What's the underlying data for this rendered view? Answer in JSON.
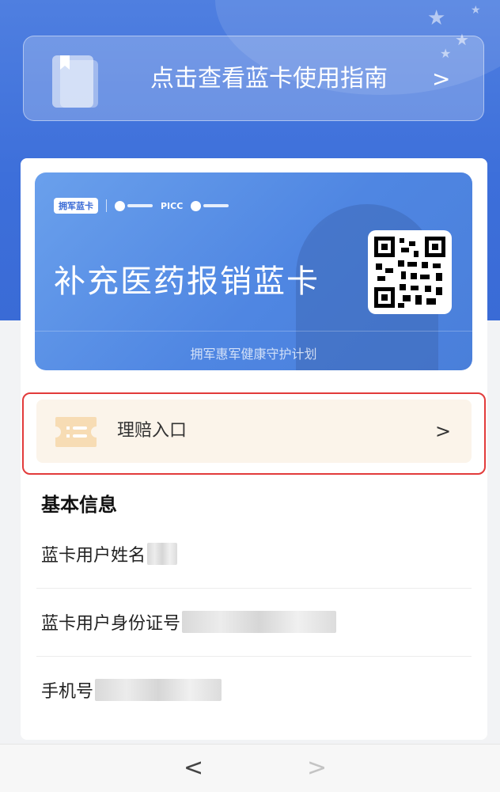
{
  "guide_banner": {
    "label": "点击查看蓝卡使用指南",
    "chevron": ">"
  },
  "blue_card": {
    "brand_badge": "拥军蓝卡",
    "partner_picc": "PICC",
    "title": "补充医药报销蓝卡",
    "footer": "拥军惠军健康守护计划",
    "qr_icon": "qr-code"
  },
  "claim_entry": {
    "label": "理赔入口",
    "chevron": ">"
  },
  "basic_info": {
    "title": "基本信息",
    "rows": [
      {
        "label": "蓝卡用户姓名"
      },
      {
        "label": "蓝卡用户身份证号"
      },
      {
        "label": "手机号"
      }
    ]
  },
  "nav": {
    "back": "<",
    "forward": ">"
  },
  "colors": {
    "primary_blue": "#3d6fda",
    "highlight_red": "#e23b3b",
    "claim_bg": "#fbf4ea"
  }
}
